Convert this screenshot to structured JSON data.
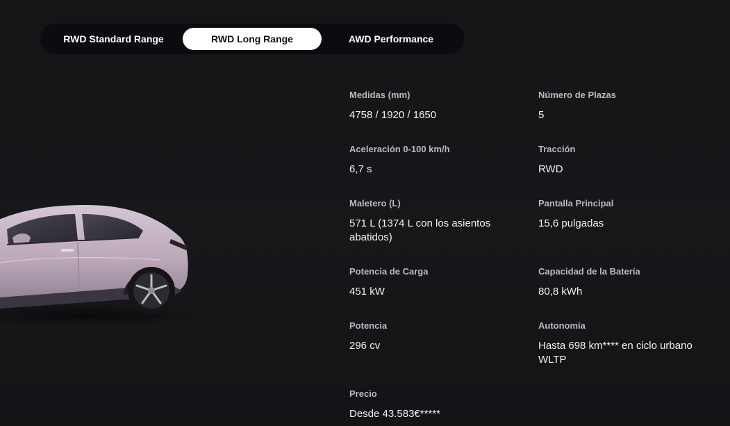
{
  "tabs": [
    {
      "label": "RWD Standard Range",
      "active": false
    },
    {
      "label": "RWD Long Range",
      "active": true
    },
    {
      "label": "AWD Performance",
      "active": false
    }
  ],
  "car_image": {
    "icon": "suv-car-illustration",
    "color": "#c9b6c8"
  },
  "specs": {
    "medidas": {
      "label": "Medidas (mm)",
      "value": "4758 / 1920 / 1650"
    },
    "plazas": {
      "label": "Número de Plazas",
      "value": "5"
    },
    "aceleracion": {
      "label": "Aceleración 0-100 km/h",
      "value": "6,7 s"
    },
    "traccion": {
      "label": "Tracción",
      "value": "RWD"
    },
    "maletero": {
      "label": "Maletero (L)",
      "value": "571 L (1374 L con los asientos abatidos)"
    },
    "pantalla": {
      "label": "Pantalla Principal",
      "value": "15,6 pulgadas"
    },
    "potencia_carga": {
      "label": "Potencia de Carga",
      "value": "451 kW"
    },
    "bateria": {
      "label": "Capacidad de la Batería",
      "value": "80,8 kWh"
    },
    "potencia": {
      "label": "Potencia",
      "value": "296 cv"
    },
    "autonomia": {
      "label": "Autonomía",
      "value": "Hasta 698 km**** en ciclo urbano WLTP"
    },
    "precio": {
      "label": "Precio",
      "value": "Desde 43.583€*****"
    }
  }
}
